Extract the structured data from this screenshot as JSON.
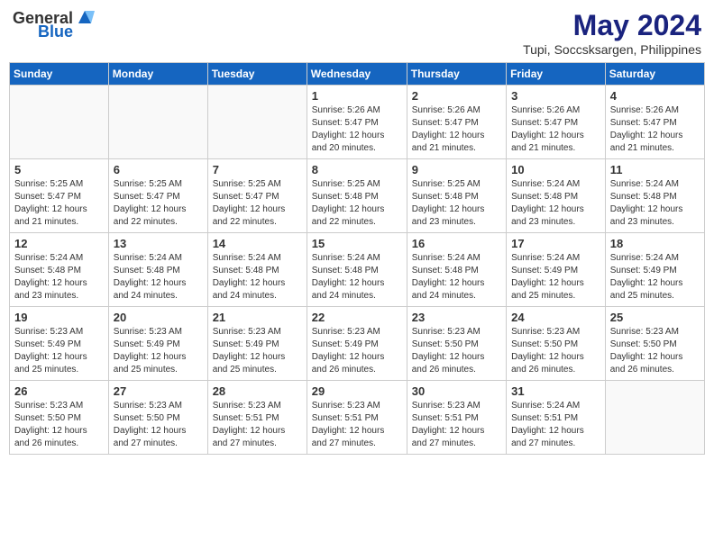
{
  "logo": {
    "general": "General",
    "blue": "Blue"
  },
  "header": {
    "title": "May 2024",
    "subtitle": "Tupi, Soccsksargen, Philippines"
  },
  "weekdays": [
    "Sunday",
    "Monday",
    "Tuesday",
    "Wednesday",
    "Thursday",
    "Friday",
    "Saturday"
  ],
  "weeks": [
    [
      {
        "day": "",
        "info": ""
      },
      {
        "day": "",
        "info": ""
      },
      {
        "day": "",
        "info": ""
      },
      {
        "day": "1",
        "info": "Sunrise: 5:26 AM\nSunset: 5:47 PM\nDaylight: 12 hours\nand 20 minutes."
      },
      {
        "day": "2",
        "info": "Sunrise: 5:26 AM\nSunset: 5:47 PM\nDaylight: 12 hours\nand 21 minutes."
      },
      {
        "day": "3",
        "info": "Sunrise: 5:26 AM\nSunset: 5:47 PM\nDaylight: 12 hours\nand 21 minutes."
      },
      {
        "day": "4",
        "info": "Sunrise: 5:26 AM\nSunset: 5:47 PM\nDaylight: 12 hours\nand 21 minutes."
      }
    ],
    [
      {
        "day": "5",
        "info": "Sunrise: 5:25 AM\nSunset: 5:47 PM\nDaylight: 12 hours\nand 21 minutes."
      },
      {
        "day": "6",
        "info": "Sunrise: 5:25 AM\nSunset: 5:47 PM\nDaylight: 12 hours\nand 22 minutes."
      },
      {
        "day": "7",
        "info": "Sunrise: 5:25 AM\nSunset: 5:47 PM\nDaylight: 12 hours\nand 22 minutes."
      },
      {
        "day": "8",
        "info": "Sunrise: 5:25 AM\nSunset: 5:48 PM\nDaylight: 12 hours\nand 22 minutes."
      },
      {
        "day": "9",
        "info": "Sunrise: 5:25 AM\nSunset: 5:48 PM\nDaylight: 12 hours\nand 23 minutes."
      },
      {
        "day": "10",
        "info": "Sunrise: 5:24 AM\nSunset: 5:48 PM\nDaylight: 12 hours\nand 23 minutes."
      },
      {
        "day": "11",
        "info": "Sunrise: 5:24 AM\nSunset: 5:48 PM\nDaylight: 12 hours\nand 23 minutes."
      }
    ],
    [
      {
        "day": "12",
        "info": "Sunrise: 5:24 AM\nSunset: 5:48 PM\nDaylight: 12 hours\nand 23 minutes."
      },
      {
        "day": "13",
        "info": "Sunrise: 5:24 AM\nSunset: 5:48 PM\nDaylight: 12 hours\nand 24 minutes."
      },
      {
        "day": "14",
        "info": "Sunrise: 5:24 AM\nSunset: 5:48 PM\nDaylight: 12 hours\nand 24 minutes."
      },
      {
        "day": "15",
        "info": "Sunrise: 5:24 AM\nSunset: 5:48 PM\nDaylight: 12 hours\nand 24 minutes."
      },
      {
        "day": "16",
        "info": "Sunrise: 5:24 AM\nSunset: 5:48 PM\nDaylight: 12 hours\nand 24 minutes."
      },
      {
        "day": "17",
        "info": "Sunrise: 5:24 AM\nSunset: 5:49 PM\nDaylight: 12 hours\nand 25 minutes."
      },
      {
        "day": "18",
        "info": "Sunrise: 5:24 AM\nSunset: 5:49 PM\nDaylight: 12 hours\nand 25 minutes."
      }
    ],
    [
      {
        "day": "19",
        "info": "Sunrise: 5:23 AM\nSunset: 5:49 PM\nDaylight: 12 hours\nand 25 minutes."
      },
      {
        "day": "20",
        "info": "Sunrise: 5:23 AM\nSunset: 5:49 PM\nDaylight: 12 hours\nand 25 minutes."
      },
      {
        "day": "21",
        "info": "Sunrise: 5:23 AM\nSunset: 5:49 PM\nDaylight: 12 hours\nand 25 minutes."
      },
      {
        "day": "22",
        "info": "Sunrise: 5:23 AM\nSunset: 5:49 PM\nDaylight: 12 hours\nand 26 minutes."
      },
      {
        "day": "23",
        "info": "Sunrise: 5:23 AM\nSunset: 5:50 PM\nDaylight: 12 hours\nand 26 minutes."
      },
      {
        "day": "24",
        "info": "Sunrise: 5:23 AM\nSunset: 5:50 PM\nDaylight: 12 hours\nand 26 minutes."
      },
      {
        "day": "25",
        "info": "Sunrise: 5:23 AM\nSunset: 5:50 PM\nDaylight: 12 hours\nand 26 minutes."
      }
    ],
    [
      {
        "day": "26",
        "info": "Sunrise: 5:23 AM\nSunset: 5:50 PM\nDaylight: 12 hours\nand 26 minutes."
      },
      {
        "day": "27",
        "info": "Sunrise: 5:23 AM\nSunset: 5:50 PM\nDaylight: 12 hours\nand 27 minutes."
      },
      {
        "day": "28",
        "info": "Sunrise: 5:23 AM\nSunset: 5:51 PM\nDaylight: 12 hours\nand 27 minutes."
      },
      {
        "day": "29",
        "info": "Sunrise: 5:23 AM\nSunset: 5:51 PM\nDaylight: 12 hours\nand 27 minutes."
      },
      {
        "day": "30",
        "info": "Sunrise: 5:23 AM\nSunset: 5:51 PM\nDaylight: 12 hours\nand 27 minutes."
      },
      {
        "day": "31",
        "info": "Sunrise: 5:24 AM\nSunset: 5:51 PM\nDaylight: 12 hours\nand 27 minutes."
      },
      {
        "day": "",
        "info": ""
      }
    ]
  ]
}
